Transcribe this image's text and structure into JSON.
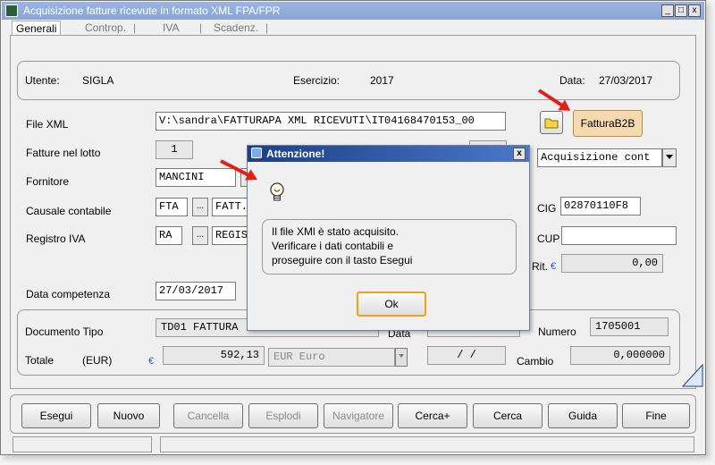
{
  "window": {
    "title": "Acquisizione fatture ricevute in formato XML FPA/FPR",
    "min_glyph": "_",
    "max_glyph": "□",
    "close_glyph": "x"
  },
  "tabs": [
    "Generali",
    "Controp.",
    "IVA",
    "Scadenz."
  ],
  "tab_separator": "|",
  "header": {
    "user_label": "Utente:",
    "user_value": "SIGLA",
    "year_label": "Esercizio:",
    "year_value": "2017",
    "date_label": "Data:",
    "date_value": "27/03/2017"
  },
  "form": {
    "file_label": "File XML",
    "file_value": "V:\\sandra\\FATTURAPA XML RICEVUTI\\IT04168470153_00",
    "b2b_button": "FatturaB2B",
    "lotto_label": "Fatture nel lotto",
    "lotto_value": "1",
    "fornitore_label": "Fornitore",
    "fornitore_value": "MANCINI",
    "causale_label": "Causale contabile",
    "causale_code": "FTA",
    "causale_desc": "FATT.",
    "registro_label": "Registro IVA",
    "registro_code": "RA",
    "registro_desc": "REGIS",
    "lookup_glyph": "...",
    "acquisizione_value": "Acquisizione cont",
    "cig_label": "CIG",
    "cig_value": "02870110F8",
    "cup_label": "CUP",
    "cup_value": "",
    "rit_label": "Rit.",
    "rit_value": "0,00",
    "competenza_label": "Data competenza",
    "competenza_value": "27/03/2017"
  },
  "document": {
    "tipo_label": "Documento Tipo",
    "tipo_value": "TD01 FATTURA",
    "data_label": "Data",
    "numero_label": "Numero",
    "numero_value": "1705001",
    "totale_label": "Totale",
    "currency_label": "(EUR)",
    "totale_value": "592,13",
    "currency_value": "EUR Euro",
    "date_empty": "/ /",
    "cambio_label": "Cambio",
    "cambio_value": "0,000000"
  },
  "euro_symbol": "€",
  "dialog": {
    "title": "Attenzione!",
    "close_glyph": "x",
    "message_lines": [
      "Il file XMl è stato acquisito.",
      "Verificare i dati contabili e",
      "proseguire con il tasto Esegui"
    ],
    "ok_label": "Ok"
  },
  "buttons": {
    "esegui": "Esegui",
    "nuovo": "Nuovo",
    "cancella": "Cancella",
    "esplodi": "Esplodi",
    "navigatore": "Navigatore",
    "cercaplus": "Cerca+",
    "cerca": "Cerca",
    "guida": "Guida",
    "fine": "Fine"
  },
  "colors": {
    "annotation_arrow": "#e32018",
    "ok_button_border": "#f0a020",
    "b2b_button_bg": "#f5d9b0",
    "dialog_title_bar": "#1c3f86",
    "euro_symbol": "#1f5ac9"
  },
  "icons": {
    "folder": "folder-icon",
    "lightbulb": "lightbulb-icon",
    "dropdown": "chevron-down-icon"
  }
}
